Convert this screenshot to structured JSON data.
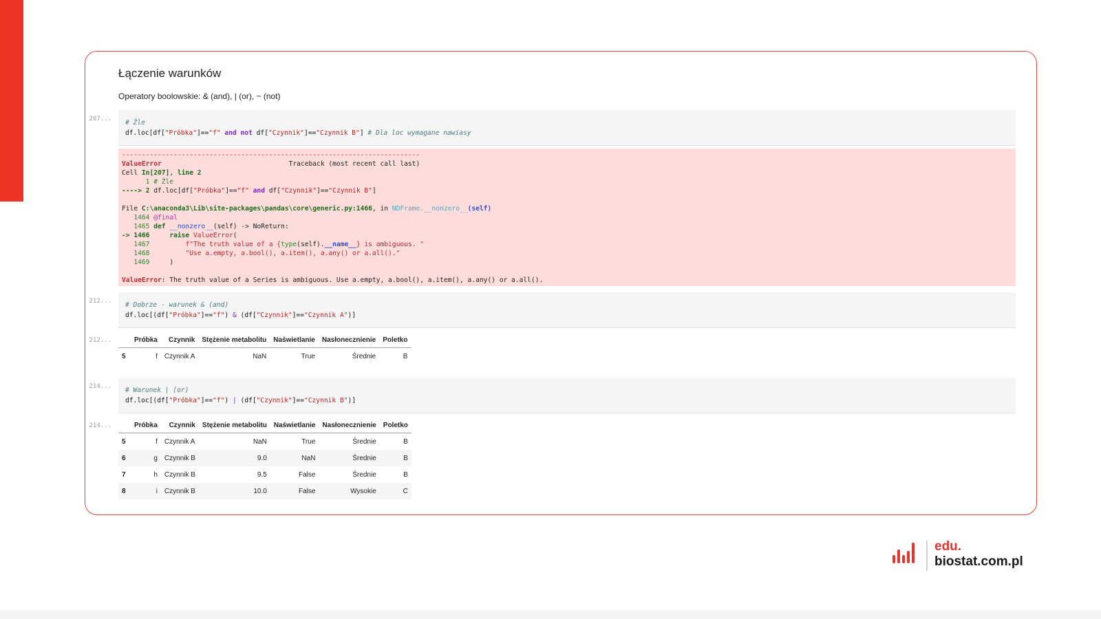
{
  "heading": "Łączenie warunków",
  "subtext": "Operatory boolowskie: & (and), | (or), ~ (not)",
  "cells": {
    "c207": {
      "prompt": "207..."
    },
    "c212": {
      "prompt": "212..."
    },
    "c212out": {
      "prompt": "212..."
    },
    "c214": {
      "prompt": "214..."
    },
    "c214out": {
      "prompt": "214..."
    }
  },
  "code1": {
    "comment": "# Źle",
    "a": "df.loc[df[",
    "s1": "\"Próbka\"",
    "b": "]==",
    "s2": "\"f\"",
    "kw": "and not",
    "c": "df[",
    "s3": "\"Czynnik\"",
    "d": "]==",
    "s4": "\"Czynnik B\"",
    "e": "]",
    "comment2": "# Dla loc wymagane nawiasy"
  },
  "error": {
    "dashes": "---------------------------------------------------------------------------",
    "name": "ValueError",
    "traceback": "Traceback (most recent call last)",
    "cell_a": "Cell ",
    "cell_b": "In[207], line 2",
    "l1": "      1 # Źle",
    "arrow": "----> 2 ",
    "l2a": "df.loc[df[",
    "l2s1": "\"Próbka\"",
    "l2b": "]==",
    "l2s2": "\"f\"",
    "l2kw": "and",
    "l2c": "df[",
    "l2s3": "\"Czynnik\"",
    "l2d": "]==",
    "l2s4": "\"Czynnik B\"",
    "l2e": "]",
    "file_a": "File ",
    "file_path": "C:\\anaconda3\\Lib\\site-packages\\pandas\\core\\generic.py:1466",
    "file_in": ", in ",
    "file_func": "NDFrame.__nonzero__",
    "file_self": "(self)",
    "n1464": "   1464 ",
    "dec": "@final",
    "n1465": "   1465 ",
    "def": "def",
    "fn": "__nonzero__",
    "sig": "(self) -> NoReturn:",
    "arr1466": "-> 1466",
    "raise": "raise",
    "exc": "ValueError",
    "paren": "(",
    "n1467": "   1467 ",
    "s1467a": "f\"The truth value of a {",
    "s1467b": "type",
    "s1467c": "(self).",
    "s1467d": "__name__",
    "s1467e": "} is ambiguous. \"",
    "n1468": "   1468 ",
    "s1468": "\"Use a.empty, a.bool(), a.item(), a.any() or a.all().\"",
    "n1469": "   1469 ",
    "close": ")",
    "final_name": "ValueError",
    "final_msg": ": The truth value of a Series is ambiguous. Use a.empty, a.bool(), a.item(), a.any() or a.all()."
  },
  "code2": {
    "comment": "# Dobrze - warunek & (and)",
    "a": "df.loc[(df[",
    "s1": "\"Próbka\"",
    "b": "]==",
    "s2": "\"f\"",
    "c": ") ",
    "op": "&",
    "d": " (df[",
    "s3": "\"Czynnik\"",
    "e": "]==",
    "s4": "\"Czynnik A\"",
    "f": ")]"
  },
  "code3": {
    "comment": "# Warunek | (or)",
    "a": "df.loc[(df[",
    "s1": "\"Próbka\"",
    "b": "]==",
    "s2": "\"f\"",
    "c": ") ",
    "op": "|",
    "d": " (df[",
    "s3": "\"Czynnik\"",
    "e": "]==",
    "s4": "\"Czynnik B\"",
    "f": ")]"
  },
  "table_headers": [
    "",
    "Próbka",
    "Czynnik",
    "Stężenie metabolitu",
    "Naświetlanie",
    "Nasłonecznienie",
    "Poletko"
  ],
  "table1_rows": [
    [
      "5",
      "f",
      "Czynnik A",
      "NaN",
      "True",
      "Średnie",
      "B"
    ]
  ],
  "table2_rows": [
    [
      "5",
      "f",
      "Czynnik A",
      "NaN",
      "True",
      "Średnie",
      "B"
    ],
    [
      "6",
      "g",
      "Czynnik B",
      "9.0",
      "NaN",
      "Średnie",
      "B"
    ],
    [
      "7",
      "h",
      "Czynnik B",
      "9.5",
      "False",
      "Średnie",
      "B"
    ],
    [
      "8",
      "i",
      "Czynnik B",
      "10.0",
      "False",
      "Wysokie",
      "C"
    ]
  ],
  "logo": {
    "line1": "edu.",
    "line2": "biostat.com.pl",
    "bars_color": "#e8342a"
  },
  "colors": {
    "accent": "#ee3524",
    "error_bg": "#fddcdc",
    "code_bg": "#f5f5f5"
  }
}
